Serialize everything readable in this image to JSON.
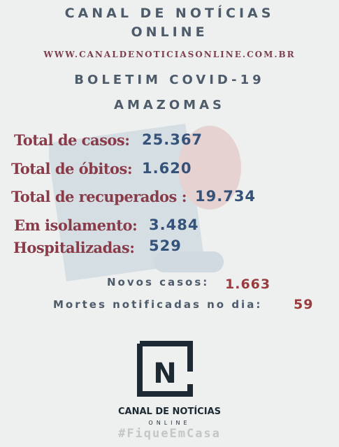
{
  "header": {
    "title_line1": "CANAL DE NOTÍCIAS",
    "title_line2": "ONLINE",
    "url": "WWW.CANALDENOTICIASONLINE.COM.BR",
    "bulletin": "BOLETIM COVID-19",
    "state": "AMAZOMAS"
  },
  "stats": [
    {
      "label": "Total de casos:",
      "value": "25.367"
    },
    {
      "label": "Total de óbitos:",
      "value": "1.620"
    },
    {
      "label": "Total de recuperados :",
      "value": "19.734"
    },
    {
      "label": "Em isolamento:",
      "value": "3.484"
    },
    {
      "label": "Hospitalizadas:",
      "value": "529"
    }
  ],
  "daily": {
    "new_cases_label": "Novos casos:",
    "new_cases_value": "1.663",
    "deaths_label": "Mortes notificadas no dia:",
    "deaths_value": "59"
  },
  "logo": {
    "letter": "N",
    "name": "CANAL DE NOTÍCIAS",
    "sub": "ONLINE",
    "icon": "news-logo-icon"
  },
  "hashtag": "#FiqueEmCasa",
  "colors": {
    "label": "#8a3b4a",
    "value": "#34527a",
    "highlight": "#9a3b3e",
    "title": "#4d5b6a"
  }
}
